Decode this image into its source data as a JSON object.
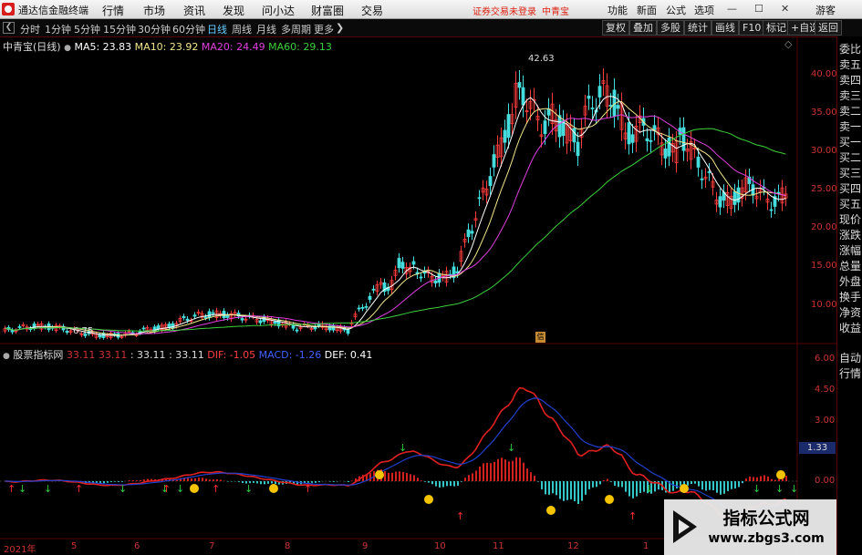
{
  "titlebar": {
    "app_name": "通达信金融终端",
    "menu": [
      "行情",
      "市场",
      "资讯",
      "发现",
      "问小达",
      "财富圈",
      "交易"
    ],
    "login_tip": "证券交易未登录",
    "security_name": "中青宝",
    "right_menu": [
      "功能",
      "新面",
      "公式",
      "选项"
    ],
    "guest": "游客"
  },
  "toolbar": {
    "periods": [
      "分时",
      "1分钟",
      "5分钟",
      "15分钟",
      "30分钟",
      "60分钟",
      "日线",
      "周线",
      "月线",
      "多周期",
      "更多"
    ],
    "active_period": "日线",
    "buttons": [
      "复权",
      "叠加",
      "多股",
      "统计",
      "画线",
      "F10",
      "标记",
      "+自选",
      "返回"
    ]
  },
  "main_panel": {
    "title": "中青宝(日线)",
    "ma": [
      {
        "label": "MA5: 23.83",
        "color": "#ffffff"
      },
      {
        "label": "MA10: 23.92",
        "color": "#f0e68c"
      },
      {
        "label": "MA20: 24.49",
        "color": "#e040e0"
      },
      {
        "label": "MA60: 29.13",
        "color": "#3cd13c"
      }
    ],
    "high_label": "42.63",
    "low_label": "6.75",
    "y_ticks": [
      "40.00",
      "35.00",
      "30.00",
      "25.00",
      "20.00",
      "15.00",
      "10.00"
    ]
  },
  "sub_panel": {
    "title": "股票指标网",
    "values": [
      {
        "label": "33.11",
        "color": "#cc3333"
      },
      {
        "label": "33.11",
        "color": "#cc3333"
      },
      {
        "label": ": 33.11",
        "color": "#dddddd"
      },
      {
        "label": ": 33.11",
        "color": "#dddddd"
      },
      {
        "label": "DIF: -1.05",
        "color": "#ff4040"
      },
      {
        "label": "MACD: -1.26",
        "color": "#4060ff"
      },
      {
        "label": "DEF: 0.41",
        "color": "#ffffff"
      }
    ],
    "y_ticks": [
      "6.00",
      "4.50",
      "3.00",
      "1.50",
      "0.00"
    ],
    "current_value": "1.33"
  },
  "x_axis": {
    "labels": [
      "2021年",
      "5",
      "6",
      "7",
      "8",
      "9",
      "10",
      "11",
      "12",
      "1"
    ]
  },
  "right_panel": {
    "items": [
      "委比",
      "卖五",
      "卖四",
      "卖三",
      "卖二",
      "卖一",
      "买一",
      "买二",
      "买三",
      "买四",
      "买五",
      "现价",
      "涨跌",
      "涨幅",
      "总量",
      "外盘",
      "换手",
      "净资",
      "收益"
    ],
    "bottom_items": [
      "自动",
      "行情"
    ]
  },
  "watermark": {
    "text1": "指标公式网",
    "text2": "www.zbgs3.com"
  },
  "colors": {
    "up": "#ff3c3c",
    "down": "#44dddd",
    "frame": "#5a0000",
    "hist_up": "#d62020",
    "hist_down": "#36c6c6"
  }
}
